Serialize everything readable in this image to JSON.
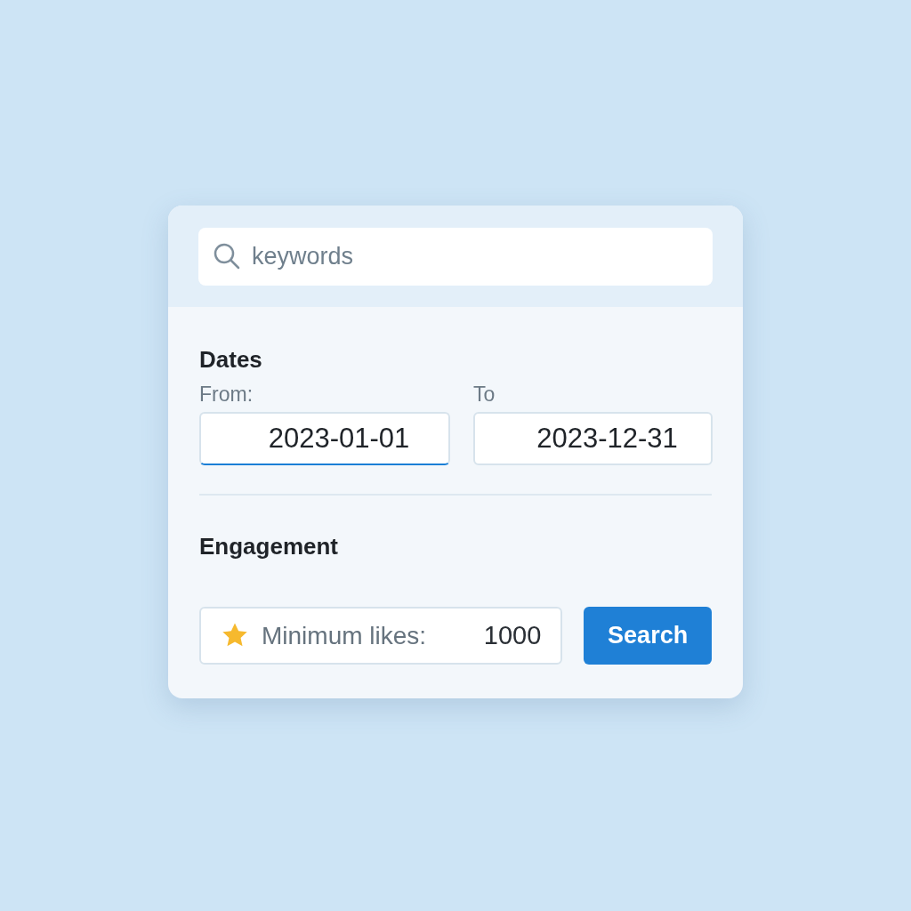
{
  "search": {
    "placeholder": "keywords"
  },
  "dates": {
    "title": "Dates",
    "fields": [
      {
        "label": "From:",
        "value": "2023-01-01",
        "focused": true
      },
      {
        "label": "To",
        "value": "2023-12-31",
        "focused": false
      }
    ]
  },
  "engagement": {
    "title": "Engagement",
    "likes_label": "Minimum likes:",
    "likes_value": "1000"
  },
  "buttons": [
    "Search"
  ]
}
